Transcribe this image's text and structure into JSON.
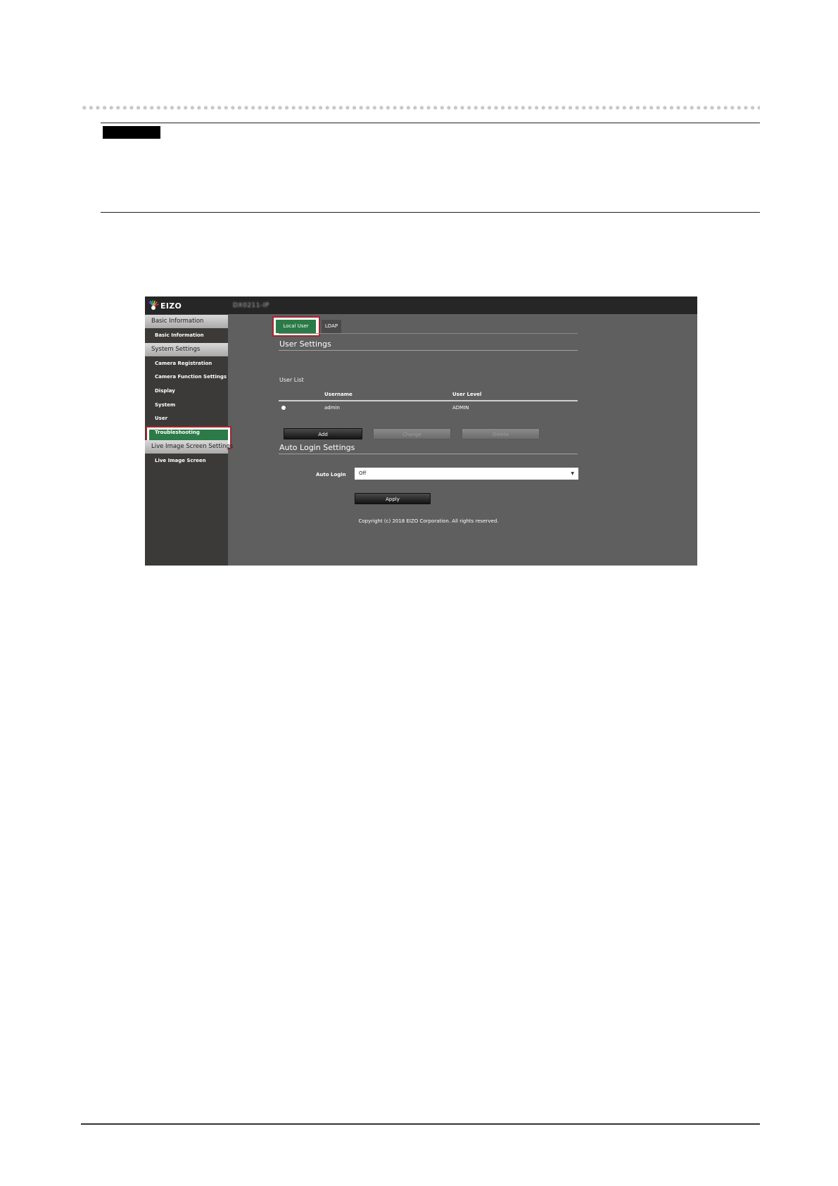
{
  "ui": {
    "logo_text": "EIZO",
    "device_name": "DX0211-IP",
    "sidebar": {
      "groups": [
        {
          "label": "Basic Information",
          "items": [
            "Basic Information"
          ]
        },
        {
          "label": "System Settings",
          "items": [
            "Camera Registration",
            "Camera Function Settings",
            "Display",
            "System",
            "User",
            "Troubleshooting"
          ]
        },
        {
          "label": "Live Image Screen Settings",
          "items": [
            "Live Image Screen"
          ]
        }
      ],
      "active_item": "User"
    },
    "tabs": [
      "Local User",
      "LDAP"
    ],
    "active_tab": "Local User",
    "user_settings": {
      "title": "User Settings",
      "list_label": "User List",
      "columns": [
        "Username",
        "User Level"
      ],
      "rows": [
        {
          "username": "admin",
          "level": "ADMIN"
        }
      ],
      "buttons": {
        "add": "Add",
        "change": "Change",
        "delete": "Delete"
      }
    },
    "auto_login": {
      "title": "Auto Login Settings",
      "label": "Auto Login",
      "value": "Off",
      "apply": "Apply"
    },
    "copyright": "Copyright (c) 2018 EIZO Corporation. All rights reserved.",
    "colors": {
      "accent_green": "#2b7a47",
      "highlight_red": "#a3262c",
      "topbar": "#262626",
      "sidebar": "#3b3a38",
      "content": "#5f5f5f"
    }
  }
}
